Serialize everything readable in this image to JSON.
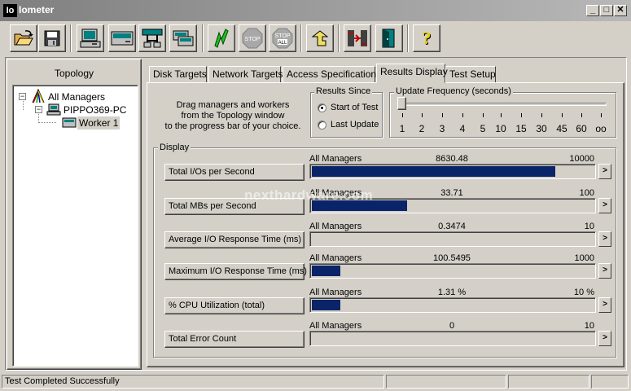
{
  "window": {
    "app_icon_text": "Io",
    "title": "Iometer",
    "minimize": "_",
    "maximize": "□",
    "close": "✕"
  },
  "toolbar": {
    "buttons": [
      {
        "name": "open-icon"
      },
      {
        "name": "save-icon"
      },
      {
        "name": "new-manager-icon"
      },
      {
        "name": "new-disk-worker-icon"
      },
      {
        "name": "new-network-worker-icon"
      },
      {
        "name": "duplicate-worker-icon"
      },
      {
        "name": "start-icon"
      },
      {
        "name": "stop-icon",
        "label": "STOP"
      },
      {
        "name": "stop-all-icon",
        "label1": "STOP",
        "label2": "ALL"
      },
      {
        "name": "reset-workers-icon"
      },
      {
        "name": "exit-icon"
      },
      {
        "name": "about-icon",
        "label": "?"
      }
    ]
  },
  "topology": {
    "title": "Topology",
    "tree": {
      "root": "All Managers",
      "manager": "PIPPO369-PC",
      "worker": "Worker 1",
      "expander_minus": "−"
    }
  },
  "tabs": [
    {
      "label": "Disk Targets",
      "active": false
    },
    {
      "label": "Network Targets",
      "active": false
    },
    {
      "label": "Access Specifications",
      "active": false
    },
    {
      "label": "Results Display",
      "active": true
    },
    {
      "label": "Test Setup",
      "active": false
    }
  ],
  "instructions": {
    "line1": "Drag managers and workers",
    "line2": "from the Topology window",
    "line3": "to the progress bar of your choice."
  },
  "results_since": {
    "title": "Results Since",
    "options": [
      "Start of Test",
      "Last Update"
    ],
    "selected": "Start of Test"
  },
  "update_frequency": {
    "title": "Update Frequency (seconds)",
    "ticks": [
      "1",
      "2",
      "3",
      "4",
      "5",
      "10",
      "15",
      "30",
      "45",
      "60",
      "oo"
    ],
    "selected": "1"
  },
  "display": {
    "title": "Display",
    "scroll_arrow": ">",
    "rows": [
      {
        "label": "Total I/Os per Second",
        "source": "All Managers",
        "value": "8630.48",
        "max": "10000",
        "fill": 0.863
      },
      {
        "label": "Total MBs per Second",
        "source": "All Managers",
        "value": "33.71",
        "max": "100",
        "fill": 0.3371
      },
      {
        "label": "Average I/O Response Time (ms)",
        "source": "All Managers",
        "value": "0.3474",
        "max": "10",
        "fill": 0.0
      },
      {
        "label": "Maximum I/O Response Time (ms)",
        "source": "All Managers",
        "value": "100.5495",
        "max": "1000",
        "fill": 0.1005
      },
      {
        "label": "% CPU Utilization (total)",
        "source": "All Managers",
        "value": "1.31 %",
        "max": "10 %",
        "fill": 0.1
      },
      {
        "label": "Total Error Count",
        "source": "All Managers",
        "value": "0",
        "max": "10",
        "fill": 0.0
      }
    ]
  },
  "watermark": "nexthardware.com",
  "status_bar": {
    "message": "Test Completed Successfully",
    "pane2": "",
    "pane3": "",
    "pane4": ""
  },
  "colors": {
    "bar_fill": "#0a246a",
    "face": "#d4d0c8",
    "title_gradient_start": "#7f7f7f"
  }
}
